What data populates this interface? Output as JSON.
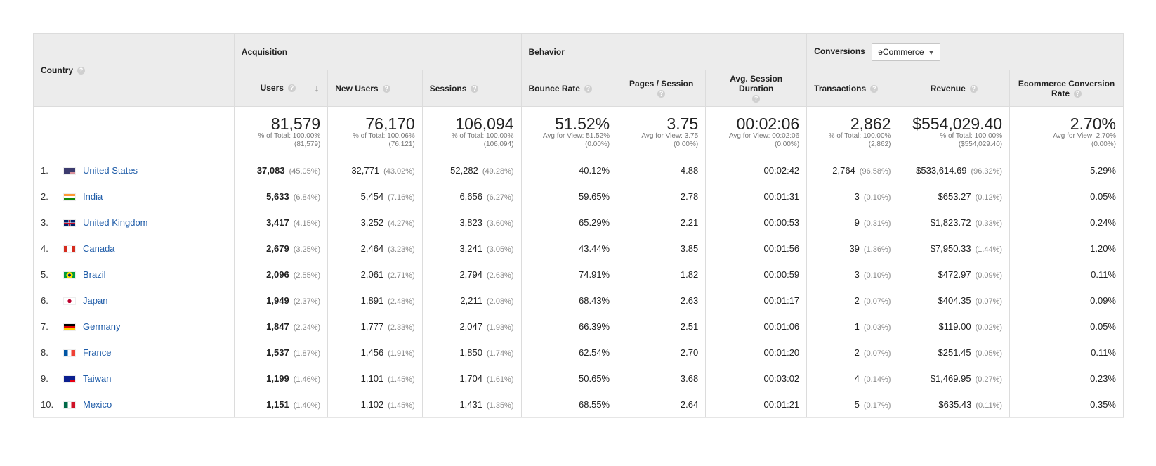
{
  "header": {
    "country": "Country",
    "groups": {
      "acquisition": "Acquisition",
      "behavior": "Behavior",
      "conversions": "Conversions",
      "conversions_select": "eCommerce"
    },
    "metrics": {
      "users": "Users",
      "new_users": "New Users",
      "sessions": "Sessions",
      "bounce_rate": "Bounce Rate",
      "pages_session": "Pages / Session",
      "avg_session_duration": "Avg. Session Duration",
      "transactions": "Transactions",
      "revenue": "Revenue",
      "ecommerce_rate": "Ecommerce Conversion Rate"
    }
  },
  "totals": {
    "users": {
      "value": "81,579",
      "sub1": "% of Total: 100.00%",
      "sub2": "(81,579)"
    },
    "new_users": {
      "value": "76,170",
      "sub1": "% of Total: 100.06%",
      "sub2": "(76,121)"
    },
    "sessions": {
      "value": "106,094",
      "sub1": "% of Total: 100.00%",
      "sub2": "(106,094)"
    },
    "bounce_rate": {
      "value": "51.52%",
      "sub1": "Avg for View: 51.52%",
      "sub2": "(0.00%)"
    },
    "pages_session": {
      "value": "3.75",
      "sub1": "Avg for View: 3.75",
      "sub2": "(0.00%)"
    },
    "avg_session_duration": {
      "value": "00:02:06",
      "sub1": "Avg for View: 00:02:06",
      "sub2": "(0.00%)"
    },
    "transactions": {
      "value": "2,862",
      "sub1": "% of Total: 100.00%",
      "sub2": "(2,862)"
    },
    "revenue": {
      "value": "$554,029.40",
      "sub1": "% of Total: 100.00%",
      "sub2": "($554,029.40)"
    },
    "ecommerce_rate": {
      "value": "2.70%",
      "sub1": "Avg for View: 2.70%",
      "sub2": "(0.00%)"
    }
  },
  "rows": [
    {
      "index": "1.",
      "country": "United States",
      "flag": "us-flag-icon",
      "users": "37,083",
      "users_pct": "(45.05%)",
      "new_users": "32,771",
      "new_users_pct": "(43.02%)",
      "sessions": "52,282",
      "sessions_pct": "(49.28%)",
      "bounce_rate": "40.12%",
      "pages_session": "4.88",
      "duration": "00:02:42",
      "transactions": "2,764",
      "transactions_pct": "(96.58%)",
      "revenue": "$533,614.69",
      "revenue_pct": "(96.32%)",
      "ecommerce_rate": "5.29%"
    },
    {
      "index": "2.",
      "country": "India",
      "flag": "india-flag-icon",
      "users": "5,633",
      "users_pct": "(6.84%)",
      "new_users": "5,454",
      "new_users_pct": "(7.16%)",
      "sessions": "6,656",
      "sessions_pct": "(6.27%)",
      "bounce_rate": "59.65%",
      "pages_session": "2.78",
      "duration": "00:01:31",
      "transactions": "3",
      "transactions_pct": "(0.10%)",
      "revenue": "$653.27",
      "revenue_pct": "(0.12%)",
      "ecommerce_rate": "0.05%"
    },
    {
      "index": "3.",
      "country": "United Kingdom",
      "flag": "uk-flag-icon",
      "users": "3,417",
      "users_pct": "(4.15%)",
      "new_users": "3,252",
      "new_users_pct": "(4.27%)",
      "sessions": "3,823",
      "sessions_pct": "(3.60%)",
      "bounce_rate": "65.29%",
      "pages_session": "2.21",
      "duration": "00:00:53",
      "transactions": "9",
      "transactions_pct": "(0.31%)",
      "revenue": "$1,823.72",
      "revenue_pct": "(0.33%)",
      "ecommerce_rate": "0.24%"
    },
    {
      "index": "4.",
      "country": "Canada",
      "flag": "canada-flag-icon",
      "users": "2,679",
      "users_pct": "(3.25%)",
      "new_users": "2,464",
      "new_users_pct": "(3.23%)",
      "sessions": "3,241",
      "sessions_pct": "(3.05%)",
      "bounce_rate": "43.44%",
      "pages_session": "3.85",
      "duration": "00:01:56",
      "transactions": "39",
      "transactions_pct": "(1.36%)",
      "revenue": "$7,950.33",
      "revenue_pct": "(1.44%)",
      "ecommerce_rate": "1.20%"
    },
    {
      "index": "5.",
      "country": "Brazil",
      "flag": "brazil-flag-icon",
      "users": "2,096",
      "users_pct": "(2.55%)",
      "new_users": "2,061",
      "new_users_pct": "(2.71%)",
      "sessions": "2,794",
      "sessions_pct": "(2.63%)",
      "bounce_rate": "74.91%",
      "pages_session": "1.82",
      "duration": "00:00:59",
      "transactions": "3",
      "transactions_pct": "(0.10%)",
      "revenue": "$472.97",
      "revenue_pct": "(0.09%)",
      "ecommerce_rate": "0.11%"
    },
    {
      "index": "6.",
      "country": "Japan",
      "flag": "japan-flag-icon",
      "users": "1,949",
      "users_pct": "(2.37%)",
      "new_users": "1,891",
      "new_users_pct": "(2.48%)",
      "sessions": "2,211",
      "sessions_pct": "(2.08%)",
      "bounce_rate": "68.43%",
      "pages_session": "2.63",
      "duration": "00:01:17",
      "transactions": "2",
      "transactions_pct": "(0.07%)",
      "revenue": "$404.35",
      "revenue_pct": "(0.07%)",
      "ecommerce_rate": "0.09%"
    },
    {
      "index": "7.",
      "country": "Germany",
      "flag": "germany-flag-icon",
      "users": "1,847",
      "users_pct": "(2.24%)",
      "new_users": "1,777",
      "new_users_pct": "(2.33%)",
      "sessions": "2,047",
      "sessions_pct": "(1.93%)",
      "bounce_rate": "66.39%",
      "pages_session": "2.51",
      "duration": "00:01:06",
      "transactions": "1",
      "transactions_pct": "(0.03%)",
      "revenue": "$119.00",
      "revenue_pct": "(0.02%)",
      "ecommerce_rate": "0.05%"
    },
    {
      "index": "8.",
      "country": "France",
      "flag": "france-flag-icon",
      "users": "1,537",
      "users_pct": "(1.87%)",
      "new_users": "1,456",
      "new_users_pct": "(1.91%)",
      "sessions": "1,850",
      "sessions_pct": "(1.74%)",
      "bounce_rate": "62.54%",
      "pages_session": "2.70",
      "duration": "00:01:20",
      "transactions": "2",
      "transactions_pct": "(0.07%)",
      "revenue": "$251.45",
      "revenue_pct": "(0.05%)",
      "ecommerce_rate": "0.11%"
    },
    {
      "index": "9.",
      "country": "Taiwan",
      "flag": "taiwan-flag-icon",
      "users": "1,199",
      "users_pct": "(1.46%)",
      "new_users": "1,101",
      "new_users_pct": "(1.45%)",
      "sessions": "1,704",
      "sessions_pct": "(1.61%)",
      "bounce_rate": "50.65%",
      "pages_session": "3.68",
      "duration": "00:03:02",
      "transactions": "4",
      "transactions_pct": "(0.14%)",
      "revenue": "$1,469.95",
      "revenue_pct": "(0.27%)",
      "ecommerce_rate": "0.23%"
    },
    {
      "index": "10.",
      "country": "Mexico",
      "flag": "mexico-flag-icon",
      "users": "1,151",
      "users_pct": "(1.40%)",
      "new_users": "1,102",
      "new_users_pct": "(1.45%)",
      "sessions": "1,431",
      "sessions_pct": "(1.35%)",
      "bounce_rate": "68.55%",
      "pages_session": "2.64",
      "duration": "00:01:21",
      "transactions": "5",
      "transactions_pct": "(0.17%)",
      "revenue": "$635.43",
      "revenue_pct": "(0.11%)",
      "ecommerce_rate": "0.35%"
    }
  ]
}
